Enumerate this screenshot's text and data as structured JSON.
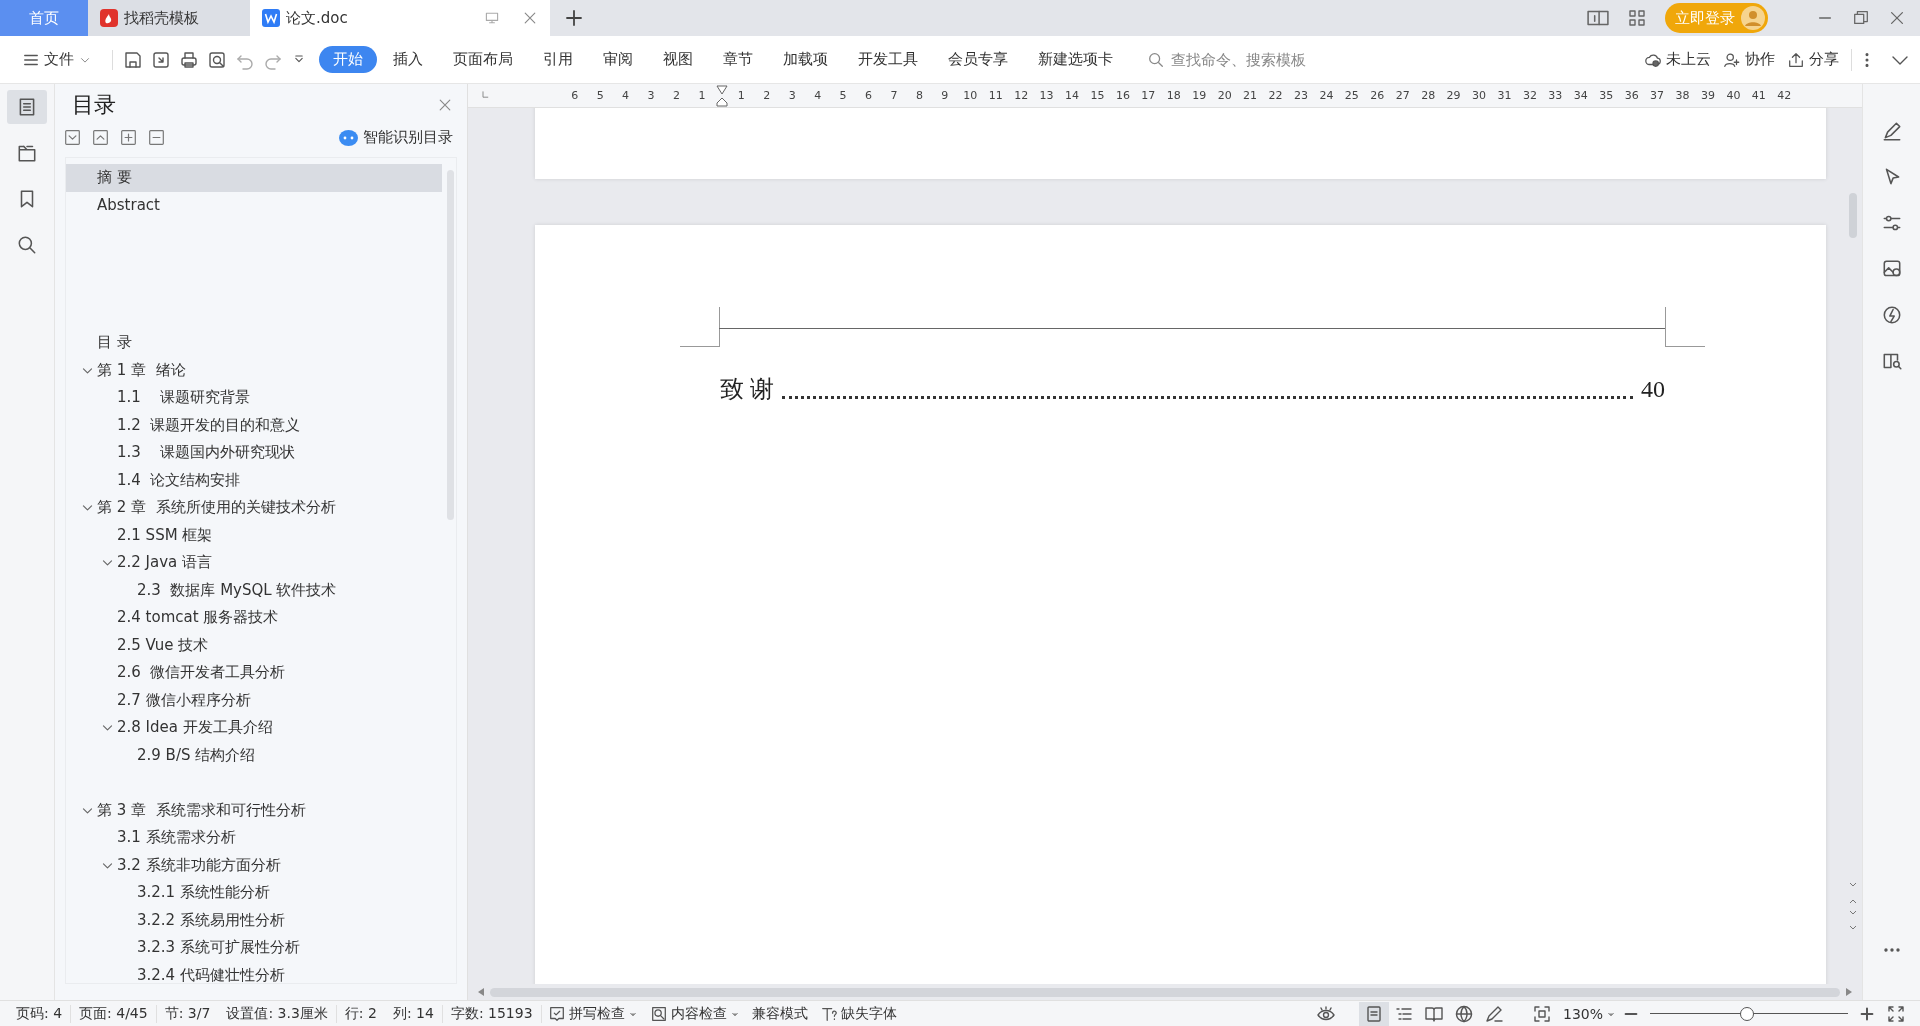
{
  "tabs": [
    {
      "label": "首页",
      "kind": "home",
      "selected": false
    },
    {
      "label": "找稻壳模板",
      "kind": "template",
      "selected": false
    },
    {
      "label": "论文.doc",
      "kind": "document",
      "selected": true
    }
  ],
  "account": {
    "login_button": "立即登录"
  },
  "toolbar": {
    "file_menu": "文件",
    "ribbon_tabs": [
      {
        "label": "开始",
        "selected": true
      },
      {
        "label": "插入",
        "selected": false
      },
      {
        "label": "页面布局",
        "selected": false
      },
      {
        "label": "引用",
        "selected": false
      },
      {
        "label": "审阅",
        "selected": false
      },
      {
        "label": "视图",
        "selected": false
      },
      {
        "label": "章节",
        "selected": false
      },
      {
        "label": "加载项",
        "selected": false
      },
      {
        "label": "开发工具",
        "selected": false
      },
      {
        "label": "会员专享",
        "selected": false
      },
      {
        "label": "新建选项卡",
        "selected": false
      }
    ],
    "search": {
      "placeholder": "查找命令、搜索模板"
    },
    "actions": [
      {
        "label": "未上云",
        "kind": "cloud"
      },
      {
        "label": "协作",
        "kind": "collab"
      },
      {
        "label": "分享",
        "kind": "share"
      }
    ]
  },
  "navigation_panel": {
    "title": "目录",
    "smart_toc_button": "智能识别目录",
    "items": [
      {
        "label": "摘 要",
        "selected": true
      },
      {
        "label": "Abstract",
        "selected": false
      },
      {
        "label": "目 录",
        "selected": false
      },
      {
        "label": "第 1 章  绪论",
        "selected": false,
        "expanded": true,
        "children": [
          {
            "label": "1.1    课题研究背景",
            "selected": false
          },
          {
            "label": "1.2  课题开发的目的和意义",
            "selected": false
          },
          {
            "label": "1.3    课题国内外研究现状",
            "selected": false
          },
          {
            "label": "1.4  论文结构安排",
            "selected": false
          }
        ]
      },
      {
        "label": "第 2 章  系统所使用的关键技术分析",
        "selected": false,
        "expanded": true,
        "children": [
          {
            "label": "2.1 SSM 框架",
            "selected": false
          },
          {
            "label": "2.2 Java 语言",
            "selected": false,
            "expanded": true,
            "children": [
              {
                "label": "2.3  数据库 MySQL 软件技术",
                "selected": false
              }
            ]
          },
          {
            "label": "2.4 tomcat 服务器技术",
            "selected": false
          },
          {
            "label": "2.5 Vue 技术",
            "selected": false
          },
          {
            "label": "2.6  微信开发者工具分析",
            "selected": false
          },
          {
            "label": "2.7 微信小程序分析",
            "selected": false
          },
          {
            "label": "2.8 Idea 开发工具介绍",
            "selected": false,
            "expanded": true,
            "children": [
              {
                "label": "2.9 B/S 结构介绍",
                "selected": false
              }
            ]
          }
        ]
      },
      {
        "label": "第 3 章  系统需求和可行性分析",
        "selected": false,
        "expanded": true,
        "children": [
          {
            "label": "3.1 系统需求分析",
            "selected": false
          },
          {
            "label": "3.2 系统非功能方面分析",
            "selected": false,
            "expanded": true,
            "children": [
              {
                "label": "3.2.1 系统性能分析",
                "selected": false
              },
              {
                "label": "3.2.2 系统易用性分析",
                "selected": false
              },
              {
                "label": "3.2.3 系统可扩展性分析",
                "selected": false
              },
              {
                "label": "3.2.4 代码健壮性分析",
                "selected": false
              }
            ]
          }
        ]
      }
    ]
  },
  "ruler": {
    "left_numbers": [
      "6",
      "5",
      "4",
      "3",
      "2",
      "1"
    ],
    "right_numbers": [
      "1",
      "2",
      "3",
      "4",
      "5",
      "6",
      "7",
      "8",
      "9",
      "10",
      "11",
      "12",
      "13",
      "14",
      "15",
      "16",
      "17",
      "18",
      "19",
      "20",
      "21",
      "22",
      "23",
      "24",
      "25",
      "26",
      "27",
      "28",
      "29",
      "30",
      "31",
      "32",
      "33",
      "34",
      "35",
      "36",
      "37",
      "38",
      "39",
      "40",
      "41",
      "42"
    ]
  },
  "document": {
    "toc_line": {
      "title": "致 谢",
      "page": "40"
    }
  },
  "status_bar": {
    "items": [
      "页码: 4",
      "页面: 4/45",
      "节: 3/7",
      "设置值: 3.3厘米",
      "行: 2",
      "列: 14",
      "字数: 15193"
    ],
    "spell_check": "拼写检查",
    "content_check": "内容检查",
    "compat_mode": "兼容模式",
    "missing_fonts": "缺失字体",
    "zoom": {
      "reading": "130%",
      "level": 0.49
    }
  }
}
